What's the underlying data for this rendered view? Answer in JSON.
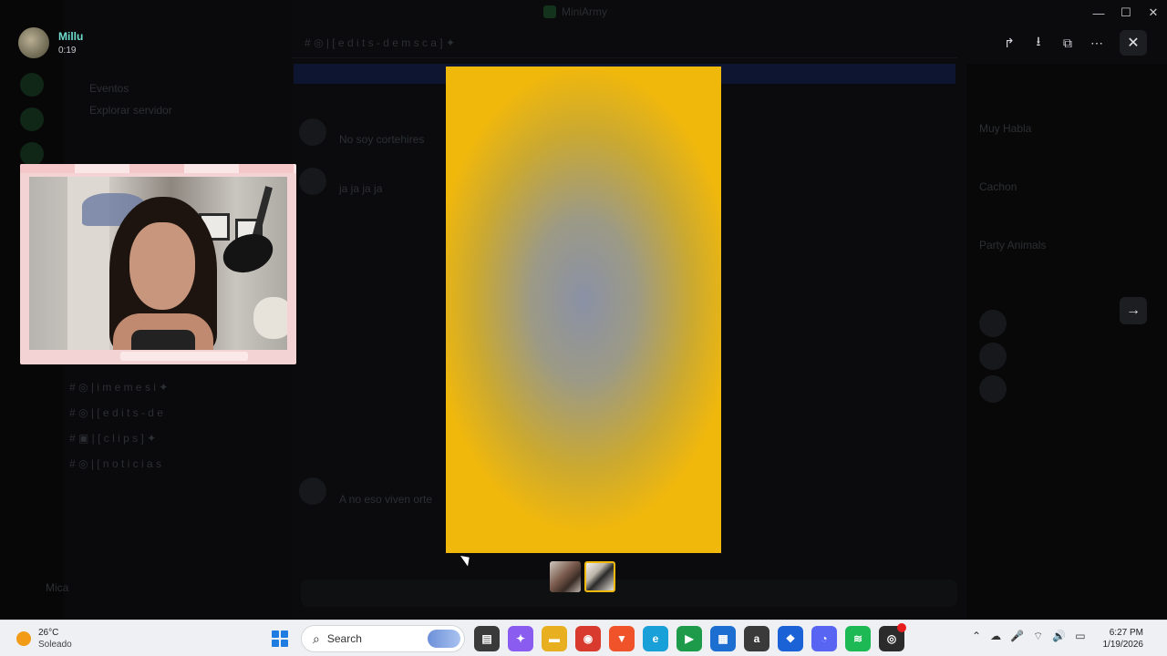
{
  "window": {
    "title": "MiniArmy"
  },
  "viewer": {
    "user_name": "Millu",
    "timestamp": "0:19",
    "actions": [
      {
        "icon": "forward-icon",
        "glyph": "↱"
      },
      {
        "icon": "download-icon",
        "glyph": "⭳"
      },
      {
        "icon": "open-external-icon",
        "glyph": "⧉"
      },
      {
        "icon": "more-icon",
        "glyph": "⋯"
      }
    ],
    "close_glyph": "✕",
    "next_glyph": "→"
  },
  "background": {
    "server_title": "MiniArmy",
    "channels": [
      "# ◎ | i m e m e s i ✦",
      "# ◎ | [ e d i t s - d e",
      "# ▣ | [ c l i p s ] ✦",
      "# ◎ | [ n o t i c i a s"
    ],
    "channel_header": "# ◎ | [ e d i t s - d e m s c a ] ✦",
    "messages": [
      "No soy cortehires",
      "ja ja ja ja",
      "A no eso viven orte"
    ],
    "members": [
      "Muy Habla",
      "Cachon",
      "Party Animals"
    ],
    "user_panel_name": "Mica"
  },
  "thumbnails": [
    {
      "id": "thumb-1",
      "selected": false
    },
    {
      "id": "thumb-2",
      "selected": true
    }
  ],
  "taskbar": {
    "weather_temp": "26°C",
    "weather_desc": "Soleado",
    "search_label": "Search",
    "apps": [
      {
        "name": "task-view-icon",
        "color": "#3a3a3a",
        "glyph": "▤"
      },
      {
        "name": "copilot-icon",
        "color": "#8a5cf0",
        "glyph": "✦"
      },
      {
        "name": "file-explorer-icon",
        "color": "#e8b021",
        "glyph": "▬"
      },
      {
        "name": "chrome-icon",
        "color": "#d93a2e",
        "glyph": "◉"
      },
      {
        "name": "brave-icon",
        "color": "#f0532a",
        "glyph": "▼"
      },
      {
        "name": "edge-icon",
        "color": "#1aa0d8",
        "glyph": "e"
      },
      {
        "name": "game-pass-icon",
        "color": "#1d9b4b",
        "glyph": "▶"
      },
      {
        "name": "store-icon",
        "color": "#1c6fd0",
        "glyph": "▦"
      },
      {
        "name": "amazon-icon",
        "color": "#3a3a3a",
        "glyph": "a"
      },
      {
        "name": "dropbox-icon",
        "color": "#1a62d6",
        "glyph": "❖"
      },
      {
        "name": "discord-icon",
        "color": "#5865f2",
        "glyph": "◔"
      },
      {
        "name": "spotify-icon",
        "color": "#1db954",
        "glyph": "≋"
      },
      {
        "name": "obs-icon",
        "color": "#2b2b2b",
        "glyph": "◎",
        "badge": true
      }
    ],
    "tray": [
      "⌃",
      "☁",
      "🎤",
      "⌔",
      "🔊",
      "▭"
    ],
    "time": "6:27 PM",
    "date": "1/19/2026"
  }
}
